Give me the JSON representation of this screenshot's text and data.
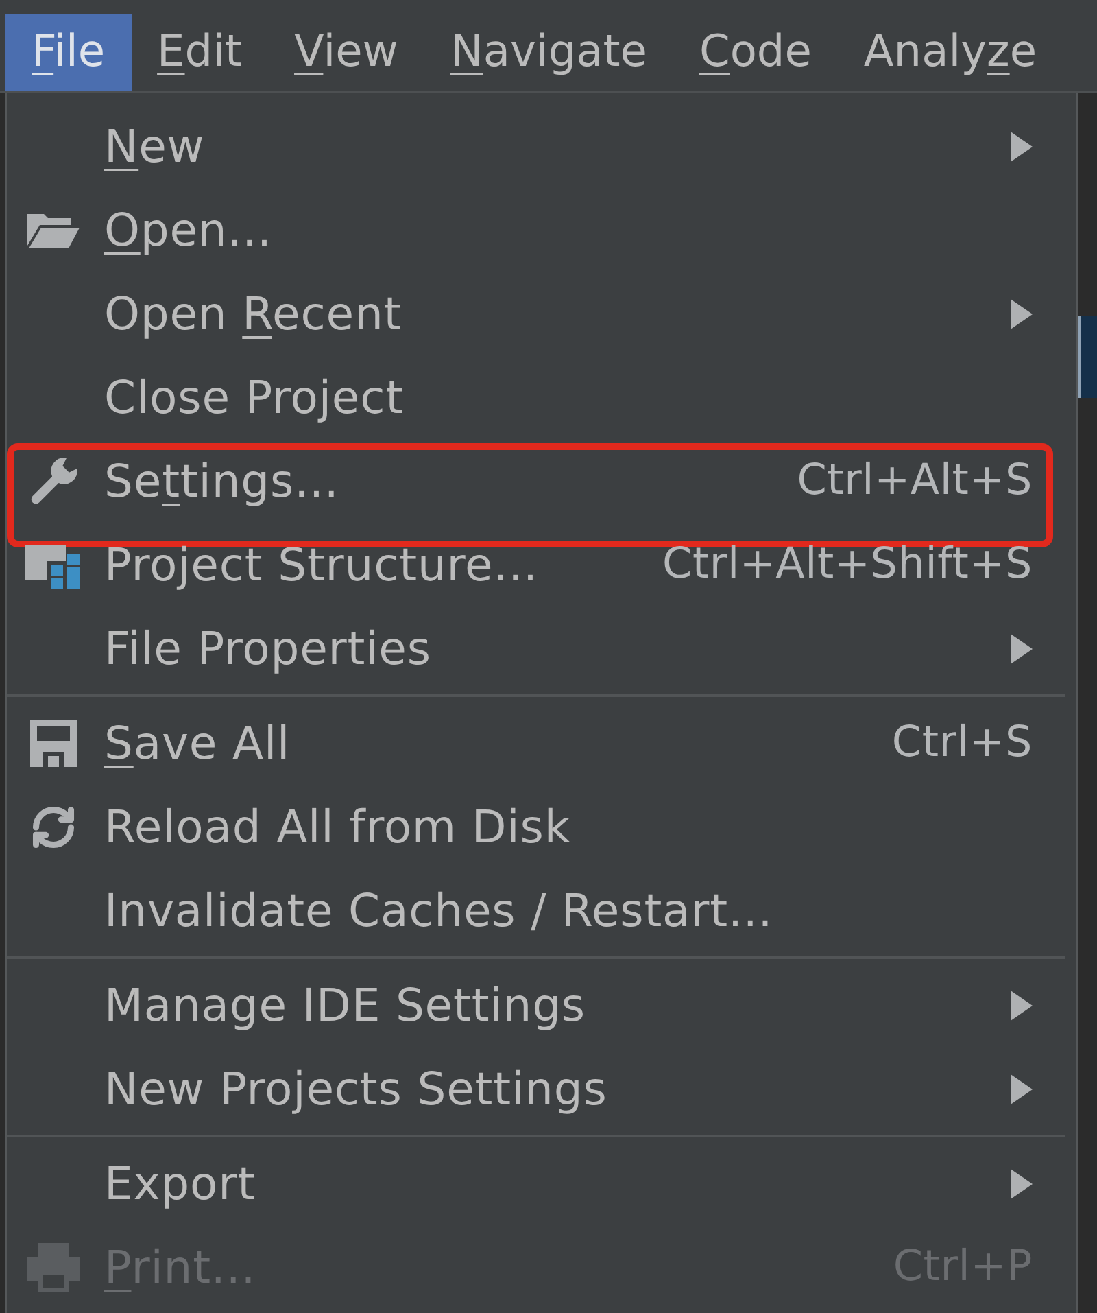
{
  "menu_bar": [
    {
      "access_key": "F",
      "label_end": "ile",
      "selected": true
    },
    {
      "access_key": "E",
      "label_end": "dit",
      "selected": false
    },
    {
      "access_key": "V",
      "label_end": "iew",
      "selected": false
    },
    {
      "access_key": "N",
      "label_end": "avigate",
      "selected": false
    },
    {
      "access_key": "C",
      "label_end": "ode",
      "selected": false
    },
    {
      "label_start": "Analy",
      "access_key": "z",
      "label_end": "e",
      "selected": false
    }
  ],
  "menu": {
    "groups": [
      {
        "items": [
          {
            "kind": "plain",
            "access_key": "N",
            "label_end": "ew",
            "submenu": true,
            "disabled": false,
            "highlighted": false
          },
          {
            "kind": "open",
            "access_key": "O",
            "label_end": "pen...",
            "submenu": false,
            "disabled": false,
            "highlighted": false
          },
          {
            "kind": "plain",
            "label_start": "Open ",
            "access_key": "R",
            "label_end": "ecent",
            "submenu": true,
            "disabled": false,
            "highlighted": false
          },
          {
            "kind": "plain",
            "label": "Close Project",
            "submenu": false,
            "disabled": false,
            "highlighted": false
          },
          {
            "kind": "settings",
            "label_start": "Se",
            "access_key": "t",
            "label_end": "tings...",
            "shortcut": "Ctrl+Alt+S",
            "submenu": false,
            "disabled": false,
            "highlighted": true
          },
          {
            "kind": "structure",
            "label": "Project Structure...",
            "shortcut": "Ctrl+Alt+Shift+S",
            "submenu": false,
            "disabled": false,
            "highlighted": false
          },
          {
            "kind": "plain",
            "label": "File Properties",
            "submenu": true,
            "disabled": false,
            "highlighted": false
          }
        ]
      },
      {
        "items": [
          {
            "kind": "save",
            "access_key": "S",
            "label_end": "ave All",
            "shortcut": "Ctrl+S",
            "submenu": false,
            "disabled": false,
            "highlighted": false
          },
          {
            "kind": "reload",
            "label": "Reload All from Disk",
            "submenu": false,
            "disabled": false,
            "highlighted": false
          },
          {
            "kind": "plain",
            "label": "Invalidate Caches / Restart...",
            "submenu": false,
            "disabled": false,
            "highlighted": false
          }
        ]
      },
      {
        "items": [
          {
            "kind": "plain",
            "label": "Manage IDE Settings",
            "submenu": true,
            "disabled": false,
            "highlighted": false
          },
          {
            "kind": "plain",
            "label": "New Projects Settings",
            "submenu": true,
            "disabled": false,
            "highlighted": false
          }
        ]
      },
      {
        "items": [
          {
            "kind": "plain",
            "label": "Export",
            "submenu": true,
            "disabled": false,
            "highlighted": false
          },
          {
            "kind": "print",
            "access_key": "P",
            "label_end": "rint...",
            "shortcut": "Ctrl+P",
            "submenu": false,
            "disabled": true,
            "highlighted": false
          }
        ]
      }
    ]
  }
}
